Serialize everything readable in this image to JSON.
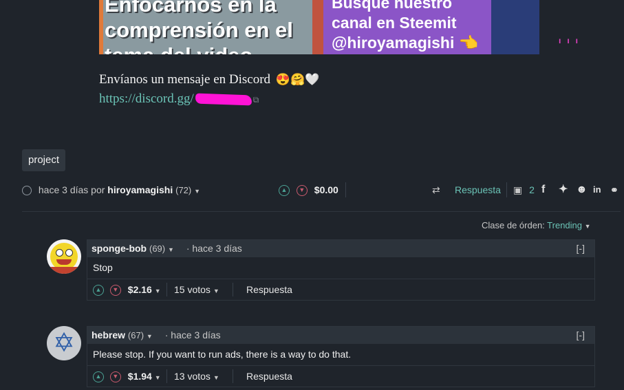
{
  "thumbnails": {
    "left_text": "Enfocarnos en la\ncomprensión en el\ntema del video",
    "right_text": "Busque nuestro\ncanal en Steemit\n@hiroyamagishi 👈"
  },
  "discord": {
    "message": "Envíanos un mensaje en Discord",
    "emojis": "😍🤗🤍",
    "link_prefix": "https://discord.gg/"
  },
  "tag": "project",
  "post_meta": {
    "time": "hace 3 días",
    "by": "por",
    "author": "hiroyamagishi",
    "reputation": "(72)",
    "payout": "$0.00",
    "reply": "Respuesta",
    "comment_count": "2",
    "social_icons": [
      "facebook-icon",
      "twitter-icon",
      "reddit-icon",
      "linkedin-icon",
      "link-icon"
    ]
  },
  "sort": {
    "label": "Clase de órden:",
    "value": "Trending"
  },
  "comments": [
    {
      "author": "sponge-bob",
      "reputation": "(69)",
      "time": "hace 3 días",
      "collapse": "[-]",
      "body": "Stop",
      "payout": "$2.16",
      "votes": "15 votos",
      "reply": "Respuesta",
      "avatar": "spongebob-avatar"
    },
    {
      "author": "hebrew",
      "reputation": "(67)",
      "time": "hace 3 días",
      "collapse": "[-]",
      "body": "Please stop. If you want to run ads, there is a way to do that.",
      "payout": "$1.94",
      "votes": "13 votos",
      "reply": "Respuesta",
      "avatar": "star-of-david-avatar"
    }
  ]
}
